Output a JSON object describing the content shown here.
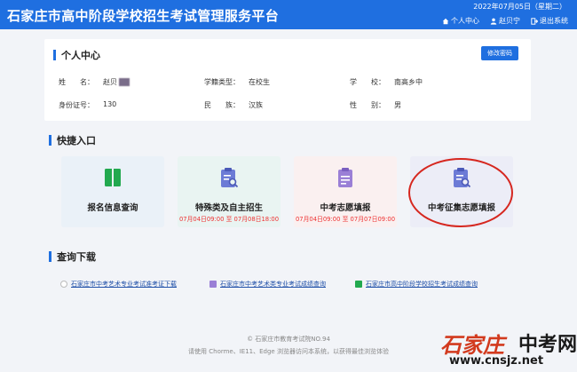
{
  "header": {
    "title": "石家庄市高中阶段学校招生考试管理服务平台",
    "date": "2022年07月05日（星期二）",
    "nav": [
      {
        "label": "个人中心",
        "icon": "home-icon"
      },
      {
        "label": "赵贝宁",
        "icon": "user-icon"
      },
      {
        "label": "退出系统",
        "icon": "logout-icon"
      }
    ]
  },
  "profile": {
    "section_title": "个人中心",
    "change_password_label": "修改密码",
    "fields": [
      {
        "label": "姓　　名：",
        "value": "赵贝"
      },
      {
        "label": "学籍类型：",
        "value": "在校生"
      },
      {
        "label": "学　　校：",
        "value": "南高乡中"
      },
      {
        "label": "身份证号：",
        "value": "130"
      },
      {
        "label": "民　　族：",
        "value": "汉族"
      },
      {
        "label": "性　　别：",
        "value": "男"
      }
    ]
  },
  "quick": {
    "section_title": "快捷入口",
    "tiles": [
      {
        "name": "报名信息查询",
        "when": "",
        "icon": "book-icon",
        "color": "#22a94f"
      },
      {
        "name": "特殊类及自主招生",
        "when": "07月04日09:00 至 07月08日18:00",
        "icon": "clipboard-search-icon",
        "color": "#6c7bd6"
      },
      {
        "name": "中考志愿填报",
        "when": "07月04日09:00 至 07月07日09:00",
        "icon": "clipboard-icon",
        "color": "#9a7fd6"
      },
      {
        "name": "中考征集志愿填报",
        "when": "",
        "icon": "clipboard-search-icon",
        "color": "#6c7bd6"
      }
    ]
  },
  "downloads": {
    "section_title": "查询下载",
    "links": [
      {
        "label": "石家庄市中考艺术专业考试准考证下载",
        "icon": "doc-icon",
        "color": "#c9c9c9"
      },
      {
        "label": "石家庄市中考艺术类专业考试成绩查询",
        "icon": "clipboard-icon",
        "color": "#9a7fd6"
      },
      {
        "label": "石家庄市高中阶段学校招生考试成绩查询",
        "icon": "book-icon",
        "color": "#22a94f"
      }
    ]
  },
  "footer": {
    "copyright": "© 石家庄市教育考试院NO.94",
    "browser_tip": "请使用 Chorme、IE11、Edge 浏览器访问本系统，以获得最佳浏览体验"
  },
  "watermark": {
    "brand": "石家庄",
    "brand2": "中考网",
    "url": "www.cnsjz.net"
  }
}
